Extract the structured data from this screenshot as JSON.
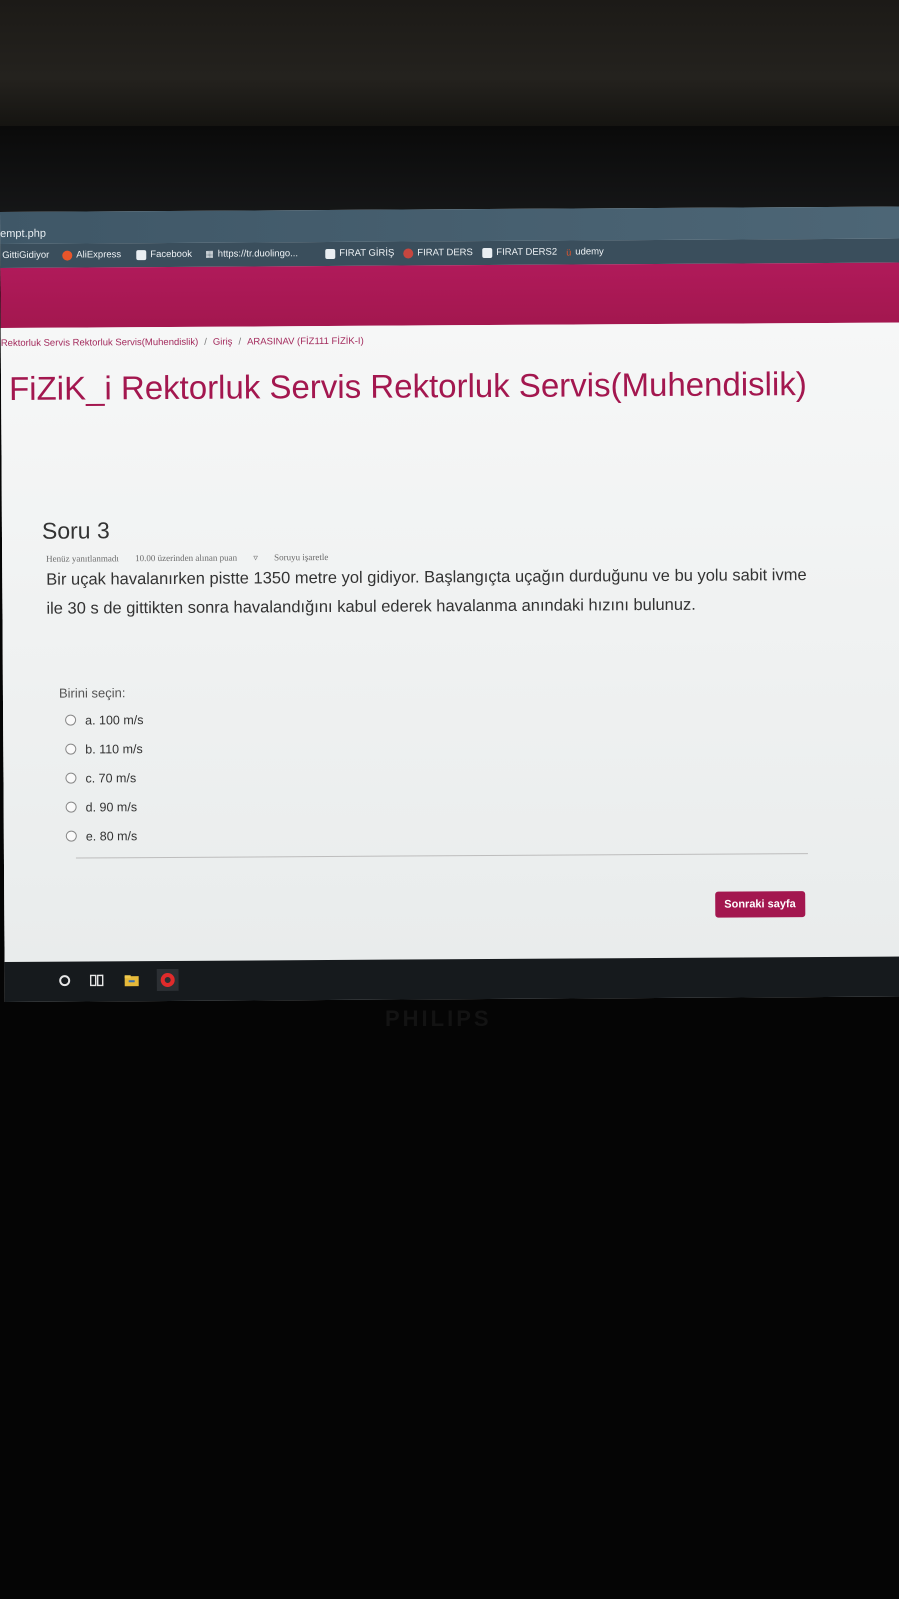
{
  "browser": {
    "url_fragment": "empt.php",
    "bookmarks": [
      {
        "label": "GittiGidiyor",
        "icon": "gittigidiyor-icon"
      },
      {
        "label": "AliExpress",
        "icon": "aliexpress-icon"
      },
      {
        "label": "Facebook",
        "icon": "page-icon"
      },
      {
        "label": "https://tr.duolingo...",
        "icon": "apps-grid-icon"
      },
      {
        "label": "FIRAT GİRİŞ",
        "icon": "page-icon"
      },
      {
        "label": "FIRAT DERS",
        "icon": "firat-icon"
      },
      {
        "label": "FIRAT DERS2",
        "icon": "page-icon"
      },
      {
        "label": "udemy",
        "icon": "udemy-icon"
      }
    ]
  },
  "breadcrumb": {
    "items": [
      "Rektorluk Servis Rektorluk Servis(Muhendislik)",
      "Giriş",
      "ARASINAV (FİZ111 FİZİK-I)"
    ],
    "separator": "/"
  },
  "page": {
    "title": "FiZiK_i Rektorluk Servis Rektorluk Servis(Muhendislik)"
  },
  "question": {
    "heading": "Soru 3",
    "status": "Henüz yanıtlanmadı",
    "grade": "10.00 üzerinden alınan puan",
    "flag_label": "Soruyu işaretle",
    "text": "Bir uçak havalanırken pistte 1350 metre yol gidiyor. Başlangıçta uçağın durduğunu ve bu yolu sabit ivme ile 30 s de gittikten sonra havalandığını kabul ederek havalanma anındaki hızını bulunuz.",
    "prompt": "Birini seçin:",
    "options": [
      "a. 100 m/s",
      "b. 110 m/s",
      "c. 70 m/s",
      "d. 90 m/s",
      "e. 80 m/s"
    ]
  },
  "actions": {
    "next_label": "Sonraki sayfa"
  },
  "monitor": {
    "brand": "PHILIPS"
  },
  "colors": {
    "brand": "#a3174f",
    "bookmarks_bar": "#3a4e5c",
    "taskbar": "#161a1d"
  }
}
